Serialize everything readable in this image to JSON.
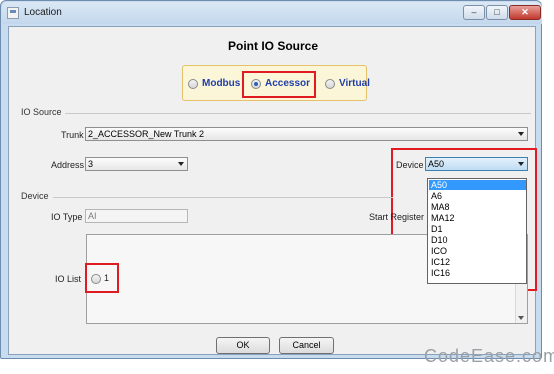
{
  "window": {
    "title": "Location",
    "min_glyph": "–",
    "max_glyph": "□",
    "close_glyph": "✕"
  },
  "heading": "Point IO Source",
  "source_options": [
    {
      "label": "Modbus",
      "selected": false
    },
    {
      "label": "Accessor",
      "selected": true
    },
    {
      "label": "Virtual",
      "selected": false
    }
  ],
  "io_source": {
    "section_label": "IO Source",
    "trunk_label": "Trunk",
    "trunk_value": "2_ACCESSOR_New Trunk 2",
    "address_label": "Address",
    "address_value": "3",
    "device_label": "Device",
    "device_value": "A50",
    "device_options": [
      "A50",
      "A6",
      "MA8",
      "MA12",
      "D1",
      "D10",
      "ICO",
      "IC12",
      "IC16"
    ]
  },
  "device_section": {
    "section_label": "Device",
    "io_type_label": "IO Type",
    "io_type_value": "AI",
    "start_register_label": "Start Register",
    "io_list_label": "IO List",
    "io_list_items": [
      {
        "label": "1",
        "selected": false
      }
    ]
  },
  "buttons": {
    "ok": "OK",
    "cancel": "Cancel"
  },
  "watermark": "CodeEase.com",
  "colors": {
    "highlight_red": "#e01b22",
    "selection_blue": "#3399ff",
    "radio_label_blue": "#1f3ea8"
  }
}
